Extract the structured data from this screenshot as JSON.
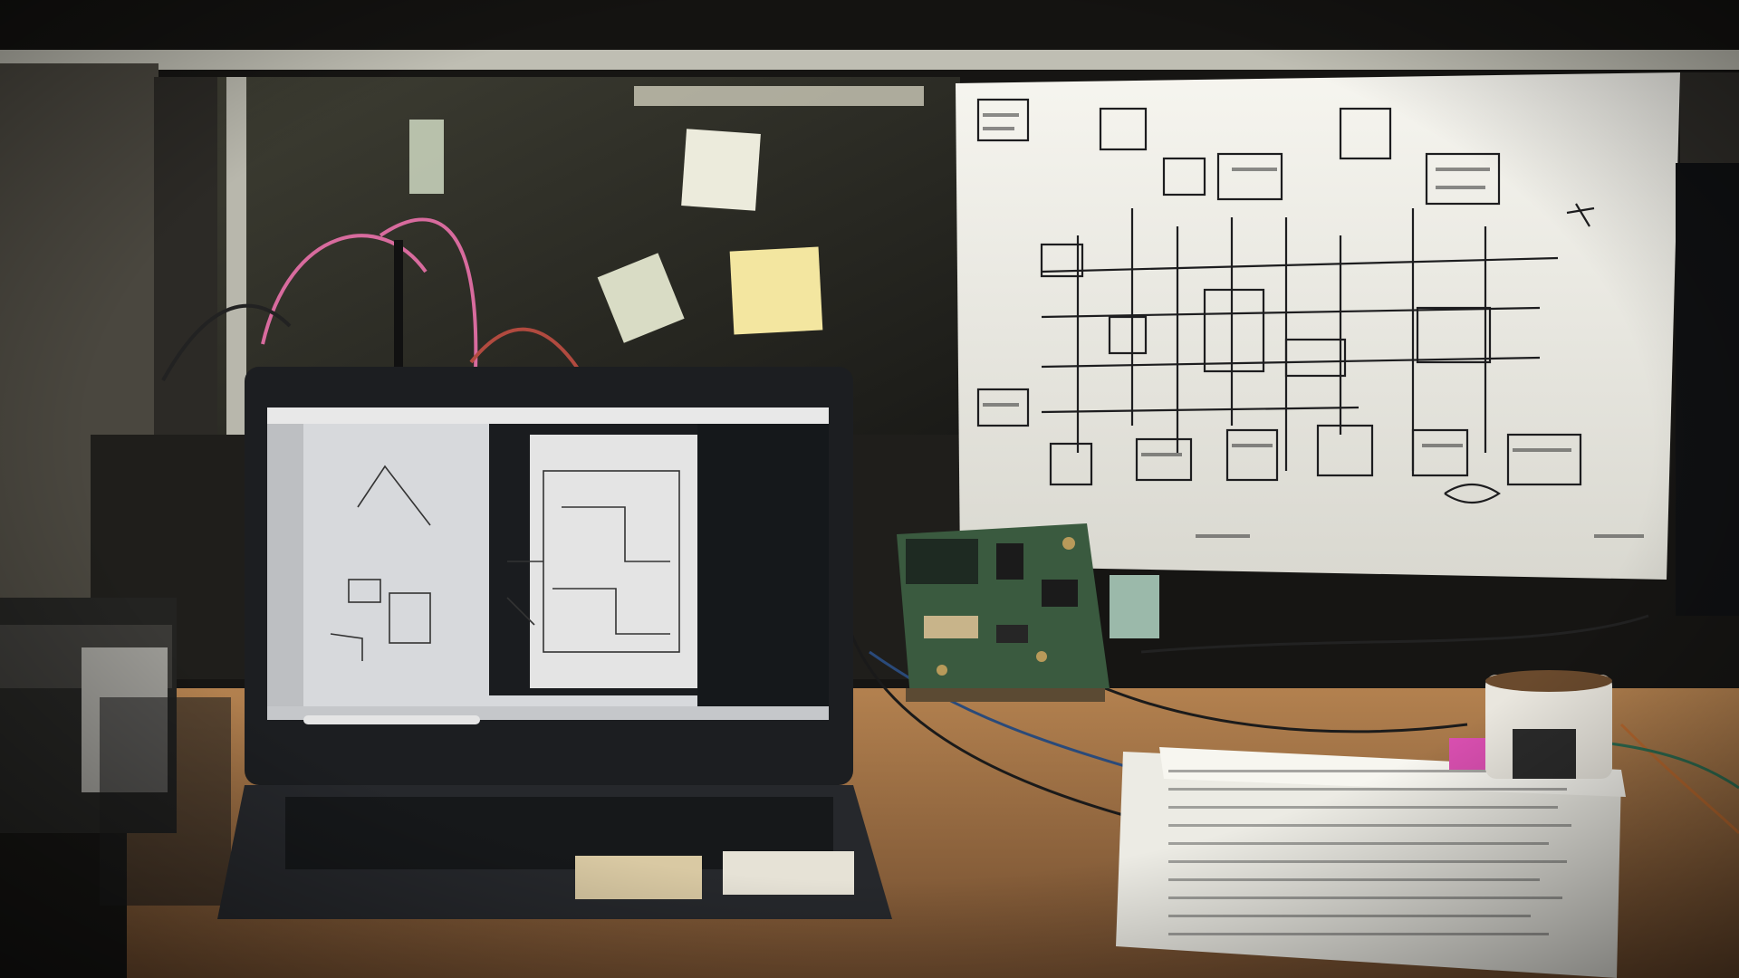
{
  "scene": {
    "description_kind": "photo",
    "palette": {
      "ceiling": "#141311",
      "window_frame": "#c7c6bb",
      "partition": "#45433c",
      "whiteboard_paper": "#f1f0ea",
      "ink": "#1d1d1f",
      "desk": "#a8764b",
      "laptop_body": "#1c1e21",
      "screen_light": "#d7d9dc",
      "screen_dark": "#15181b",
      "sticky_yellow": "#f3e6a0",
      "sticky_white": "#ecebdc",
      "pcb_green": "#3a5a3f",
      "mug": "#e9e6de",
      "cable_pink": "#d86b9e"
    },
    "icons": [
      "laptop-icon",
      "circuit-board-icon",
      "coffee-mug-icon",
      "notebook-icon",
      "sticky-note-icon"
    ]
  }
}
